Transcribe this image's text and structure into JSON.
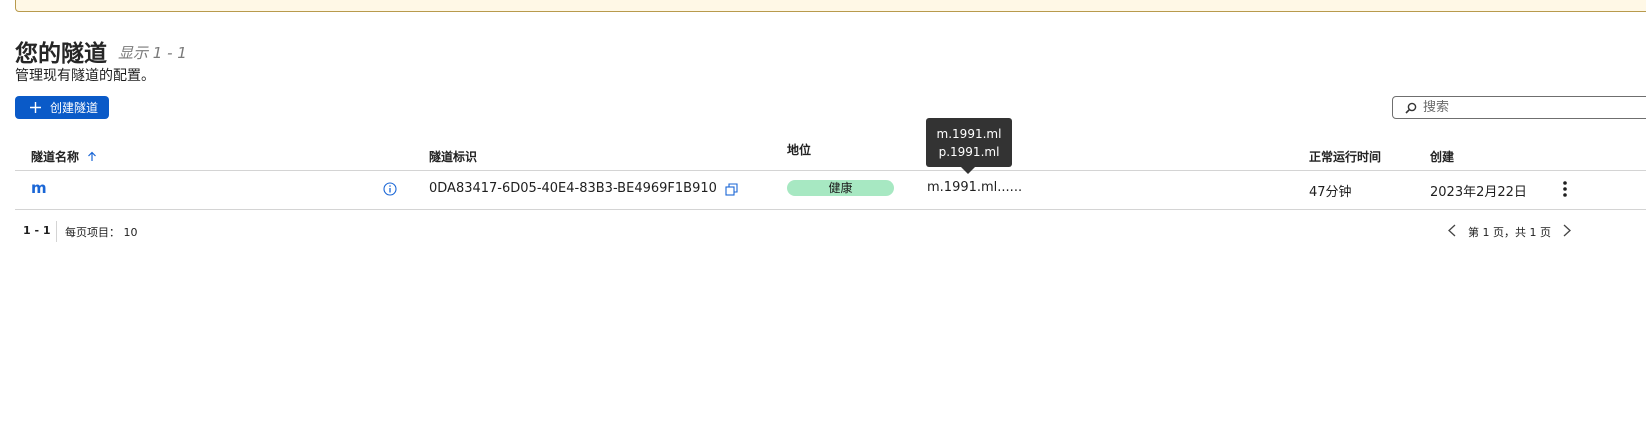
{
  "page": {
    "title": "您的隧道",
    "showing": "显示 1 - 1",
    "description": "管理现有隧道的配置。",
    "create_button_label": "创建隧道",
    "search_placeholder": "搜索"
  },
  "table": {
    "columns": {
      "name": "隧道名称",
      "id": "隧道标识",
      "status": "地位",
      "uptime": "正常运行时间",
      "created": "创建"
    },
    "sort": {
      "column": "name",
      "direction": "ascending"
    },
    "rows": [
      {
        "name": "m",
        "id": "0DA83417-6D05-40E4-83B3-BE4969F1B910",
        "status": "健康",
        "routes_truncated": "m.1991.ml......",
        "uptime": "47分钟",
        "created": "2023年2月22日"
      }
    ]
  },
  "tooltip": {
    "lines": [
      "m.1991.ml",
      "p.1991.ml"
    ]
  },
  "pagination": {
    "range": "1 - 1",
    "per_page_label": "每页项目：",
    "per_page_value": "10",
    "page_info": "第 1 页，共 1 页"
  },
  "colors": {
    "primary": "#0a5ac8",
    "link": "#1a66d6",
    "status_healthy_bg": "#a7e8c2",
    "tooltip_bg": "#333333",
    "banner_bg": "#fff8e6"
  },
  "icons": [
    "plus-icon",
    "search-icon",
    "sort-ascending-icon",
    "info-icon",
    "copy-icon",
    "more-vertical-icon",
    "chevron-left-icon",
    "chevron-right-icon"
  ]
}
